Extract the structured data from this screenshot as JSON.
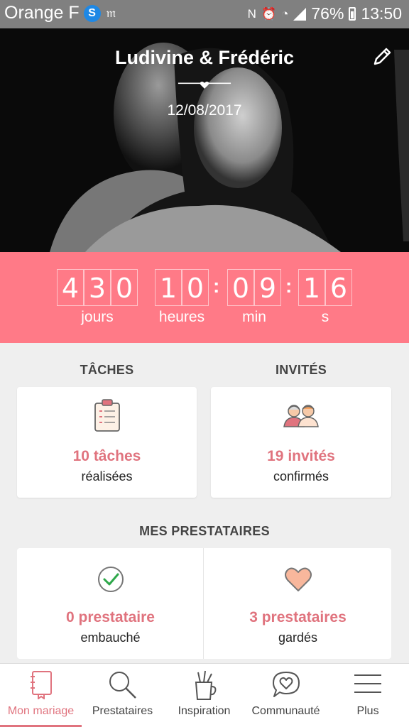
{
  "status_bar": {
    "carrier": "Orange F",
    "battery": "76%",
    "time": "13:50"
  },
  "hero": {
    "couple_names": "Ludivine & Frédéric",
    "date": "12/08/2017"
  },
  "countdown": {
    "days": [
      "4",
      "3",
      "0"
    ],
    "hours": [
      "1",
      "0"
    ],
    "minutes": [
      "0",
      "9"
    ],
    "seconds": [
      "1",
      "6"
    ],
    "labels": {
      "days": "jours",
      "hours": "heures",
      "minutes": "min",
      "seconds": "s"
    }
  },
  "tasks": {
    "heading": "TÂCHES",
    "value": "10 tâches",
    "sub": "réalisées"
  },
  "guests": {
    "heading": "INVITÉS",
    "value": "19 invités",
    "sub": "confirmés"
  },
  "vendors": {
    "heading": "MES PRESTATAIRES",
    "hired_value": "0 prestataire",
    "hired_sub": "embauché",
    "saved_value": "3 prestataires",
    "saved_sub": "gardés"
  },
  "nav": {
    "items": [
      {
        "label": "Mon mariage",
        "icon": "notebook-icon",
        "active": true
      },
      {
        "label": "Prestataires",
        "icon": "search-icon",
        "active": false
      },
      {
        "label": "Inspiration",
        "icon": "pencil-cup-icon",
        "active": false
      },
      {
        "label": "Communauté",
        "icon": "heart-bubble-icon",
        "active": false
      },
      {
        "label": "Plus",
        "icon": "menu-icon",
        "active": false
      }
    ]
  },
  "colors": {
    "accent": "#ff7a87",
    "accent_text": "#e0737e",
    "status_bar": "#808080"
  }
}
